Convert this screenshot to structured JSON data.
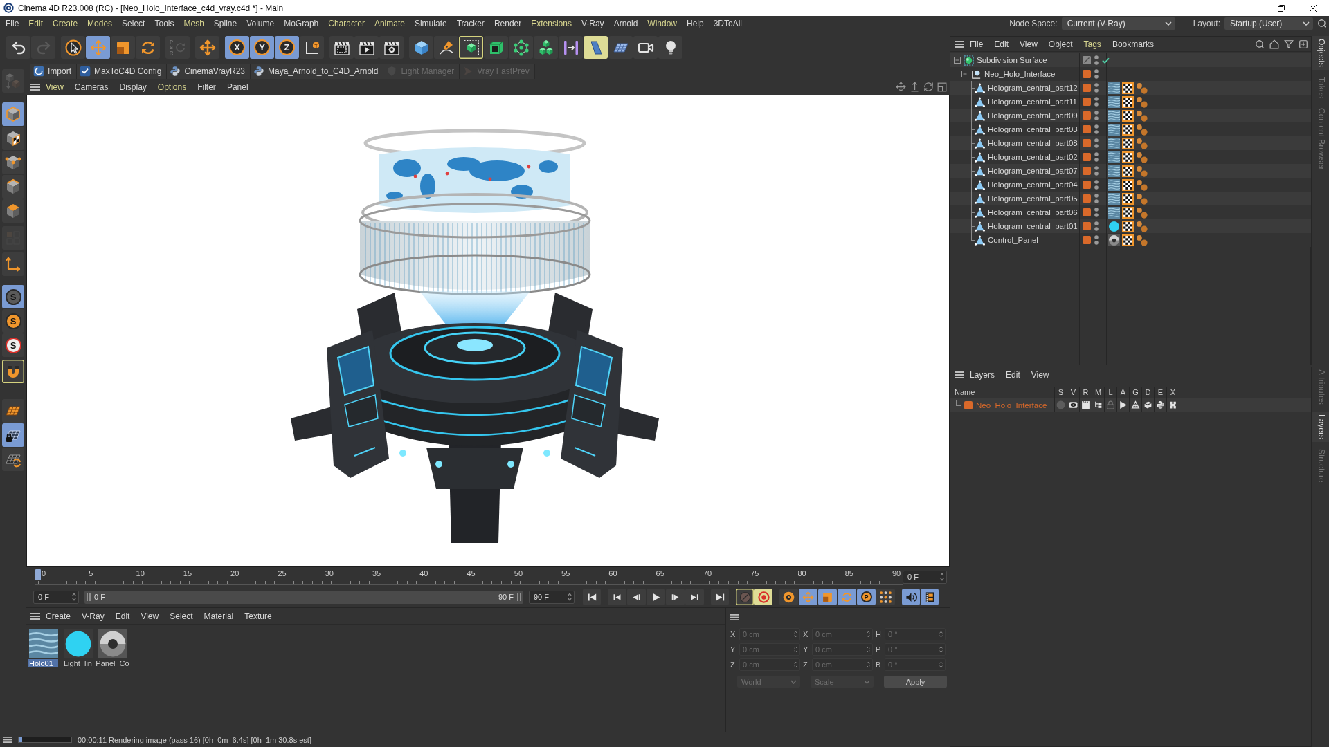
{
  "window": {
    "title": "Cinema 4D R23.008 (RC) - [Neo_Holo_Interface_c4d_vray.c4d *] - Main"
  },
  "menu_bar": [
    {
      "label": "File",
      "highlighted": false
    },
    {
      "label": "Edit",
      "highlighted": true
    },
    {
      "label": "Create",
      "highlighted": true
    },
    {
      "label": "Modes",
      "highlighted": true
    },
    {
      "label": "Select",
      "highlighted": false
    },
    {
      "label": "Tools",
      "highlighted": false
    },
    {
      "label": "Mesh",
      "highlighted": true
    },
    {
      "label": "Spline",
      "highlighted": false
    },
    {
      "label": "Volume",
      "highlighted": false
    },
    {
      "label": "MoGraph",
      "highlighted": false
    },
    {
      "label": "Character",
      "highlighted": true
    },
    {
      "label": "Animate",
      "highlighted": true
    },
    {
      "label": "Simulate",
      "highlighted": false
    },
    {
      "label": "Tracker",
      "highlighted": false
    },
    {
      "label": "Render",
      "highlighted": false
    },
    {
      "label": "Extensions",
      "highlighted": true
    },
    {
      "label": "V-Ray",
      "highlighted": false
    },
    {
      "label": "Arnold",
      "highlighted": false
    },
    {
      "label": "Window",
      "highlighted": true
    },
    {
      "label": "Help",
      "highlighted": false
    },
    {
      "label": "3DToAll",
      "highlighted": false
    }
  ],
  "node_space": {
    "label": "Node Space:",
    "value": "Current (V-Ray)"
  },
  "layout": {
    "label": "Layout:",
    "value": "Startup (User)"
  },
  "toolbar": [
    {
      "buttons": [
        {
          "kind": "undo",
          "selected": false,
          "highlighted": false,
          "outlined": false,
          "disabled": false
        },
        {
          "kind": "redo",
          "selected": false,
          "highlighted": false,
          "outlined": false,
          "disabled": true
        }
      ]
    },
    {
      "buttons": [
        {
          "kind": "select",
          "selected": false,
          "highlighted": false,
          "outlined": false,
          "disabled": false
        },
        {
          "kind": "move",
          "selected": true,
          "highlighted": false,
          "outlined": false,
          "disabled": false
        },
        {
          "kind": "scale",
          "selected": false,
          "highlighted": false,
          "outlined": false,
          "disabled": false
        },
        {
          "kind": "rotate",
          "selected": false,
          "highlighted": false,
          "outlined": false,
          "disabled": false
        }
      ]
    },
    {
      "buttons": [
        {
          "kind": "psr",
          "label": "PSR",
          "selected": false,
          "highlighted": false,
          "outlined": false,
          "disabled": true
        }
      ]
    },
    {
      "buttons": [
        {
          "kind": "axis-move",
          "selected": false,
          "highlighted": false,
          "outlined": false,
          "disabled": false
        }
      ]
    },
    {
      "buttons": [
        {
          "kind": "axis",
          "label": "X",
          "selected": true,
          "highlighted": false,
          "outlined": false,
          "disabled": false
        },
        {
          "kind": "axis",
          "label": "Y",
          "selected": true,
          "highlighted": false,
          "outlined": false,
          "disabled": false
        },
        {
          "kind": "axis",
          "label": "Z",
          "selected": true,
          "highlighted": false,
          "outlined": false,
          "disabled": false
        },
        {
          "kind": "coordinates",
          "selected": false,
          "highlighted": false,
          "outlined": false,
          "disabled": false
        }
      ]
    },
    {
      "buttons": [
        {
          "kind": "render-region",
          "selected": false,
          "highlighted": false,
          "outlined": false,
          "disabled": false
        },
        {
          "kind": "render-view",
          "selected": false,
          "highlighted": false,
          "outlined": false,
          "disabled": false
        },
        {
          "kind": "render-settings",
          "selected": false,
          "highlighted": false,
          "outlined": false,
          "disabled": false
        }
      ]
    },
    {
      "buttons": [
        {
          "kind": "cube",
          "selected": false,
          "highlighted": false,
          "outlined": false,
          "disabled": false
        },
        {
          "kind": "pen",
          "selected": false,
          "highlighted": false,
          "outlined": false,
          "disabled": false
        },
        {
          "kind": "subdivision",
          "selected": false,
          "highlighted": false,
          "outlined": true,
          "disabled": false
        },
        {
          "kind": "extrude",
          "selected": false,
          "highlighted": false,
          "outlined": false,
          "disabled": false
        },
        {
          "kind": "cloner",
          "selected": false,
          "highlighted": false,
          "outlined": false,
          "disabled": false
        },
        {
          "kind": "array",
          "selected": false,
          "highlighted": false,
          "outlined": false,
          "disabled": false
        },
        {
          "kind": "deformer",
          "selected": false,
          "highlighted": false,
          "outlined": false,
          "disabled": false
        },
        {
          "kind": "field",
          "selected": false,
          "highlighted": true,
          "outlined": false,
          "disabled": false
        },
        {
          "kind": "floor",
          "selected": false,
          "highlighted": false,
          "outlined": false,
          "disabled": false
        },
        {
          "kind": "camera",
          "selected": false,
          "highlighted": false,
          "outlined": false,
          "disabled": false
        },
        {
          "kind": "light",
          "selected": false,
          "highlighted": false,
          "outlined": false,
          "disabled": false
        }
      ]
    }
  ],
  "plugin_bar": [
    {
      "kind": "import",
      "label": "Import",
      "disabled": false
    },
    {
      "kind": "config",
      "label": "MaxToC4D Config",
      "disabled": false
    },
    {
      "kind": "script",
      "label": "CinemaVrayR23",
      "disabled": false
    },
    {
      "kind": "script",
      "label": "Maya_Arnold_to_C4D_Arnold",
      "disabled": false
    },
    {
      "kind": "light-manager",
      "label": "Light Manager",
      "disabled": true
    },
    {
      "kind": "fast-preview",
      "label": "Vray FastPrev",
      "disabled": true
    }
  ],
  "left_toolbar": [
    {
      "buttons": [
        {
          "kind": "make-editable",
          "selected": false,
          "highlighted": false,
          "outlined": false,
          "disabled": true
        }
      ]
    },
    {
      "buttons": [
        {
          "kind": "model",
          "selected": true,
          "highlighted": false,
          "outlined": false,
          "disabled": false
        },
        {
          "kind": "texture",
          "selected": false,
          "highlighted": false,
          "outlined": false,
          "disabled": false
        },
        {
          "kind": "points",
          "selected": false,
          "highlighted": false,
          "outlined": false,
          "disabled": false
        },
        {
          "kind": "edges",
          "selected": false,
          "highlighted": false,
          "outlined": false,
          "disabled": false
        },
        {
          "kind": "polygons",
          "selected": false,
          "highlighted": false,
          "outlined": false,
          "disabled": false
        }
      ]
    },
    {
      "buttons": [
        {
          "kind": "uv",
          "selected": false,
          "highlighted": false,
          "outlined": false,
          "disabled": true
        }
      ]
    },
    {
      "buttons": [
        {
          "kind": "axis-mode",
          "selected": false,
          "highlighted": false,
          "outlined": false,
          "disabled": false
        }
      ]
    },
    {
      "buttons": [
        {
          "kind": "snap",
          "label": "S",
          "selected": true,
          "highlighted": false,
          "outlined": false,
          "disabled": false
        },
        {
          "kind": "snap-quantize",
          "label": "S",
          "selected": false,
          "highlighted": false,
          "outlined": false,
          "disabled": false
        },
        {
          "kind": "snap-workplane",
          "label": "S",
          "selected": false,
          "highlighted": false,
          "outlined": false,
          "disabled": false
        }
      ]
    },
    {
      "buttons": [
        {
          "kind": "magnet",
          "selected": false,
          "highlighted": false,
          "outlined": true,
          "disabled": false
        }
      ]
    },
    {
      "buttons": [
        {
          "kind": "grid",
          "selected": false,
          "highlighted": false,
          "outlined": false,
          "disabled": false
        },
        {
          "kind": "grid-lock",
          "selected": true,
          "highlighted": false,
          "outlined": false,
          "disabled": false
        },
        {
          "kind": "grid-refresh",
          "selected": false,
          "highlighted": false,
          "outlined": false,
          "disabled": false
        }
      ]
    }
  ],
  "viewport": {
    "menu": [
      {
        "label": "View",
        "highlighted": true
      },
      {
        "label": "Cameras",
        "highlighted": false
      },
      {
        "label": "Display",
        "highlighted": false
      },
      {
        "label": "Options",
        "highlighted": true
      },
      {
        "label": "Filter",
        "highlighted": false
      },
      {
        "label": "Panel",
        "highlighted": false
      }
    ]
  },
  "timeline": {
    "ticks": [
      "0",
      "5",
      "10",
      "15",
      "20",
      "25",
      "30",
      "35",
      "40",
      "45",
      "50",
      "55",
      "60",
      "65",
      "70",
      "75",
      "80",
      "85",
      "90"
    ],
    "playhead": {
      "level": 0
    },
    "frame": "0 F"
  },
  "time_controls": {
    "start": "0 F",
    "range": {
      "start": "0 F",
      "end": "90 F",
      "handles": [
        {
          "level": 0
        },
        {
          "level": 1
        }
      ]
    },
    "end": "90 F",
    "groups": [
      {
        "buttons": [
          {
            "kind": "go-start",
            "selected": false,
            "highlighted": false,
            "outlined": false
          }
        ]
      },
      {
        "buttons": [
          {
            "kind": "prev-key",
            "selected": false,
            "highlighted": false,
            "outlined": false
          },
          {
            "kind": "prev-frame",
            "selected": false,
            "highlighted": false,
            "outlined": false
          },
          {
            "kind": "play",
            "selected": false,
            "highlighted": false,
            "outlined": false
          },
          {
            "kind": "next-frame",
            "selected": false,
            "highlighted": false,
            "outlined": false
          },
          {
            "kind": "next-key",
            "selected": false,
            "highlighted": false,
            "outlined": false
          }
        ]
      },
      {
        "buttons": [
          {
            "kind": "go-end",
            "selected": false,
            "highlighted": false,
            "outlined": false
          }
        ]
      },
      {
        "buttons": [
          {
            "kind": "auto-key",
            "selected": false,
            "highlighted": false,
            "outlined": true
          },
          {
            "kind": "record",
            "selected": false,
            "highlighted": true,
            "outlined": false
          }
        ]
      },
      {
        "buttons": [
          {
            "kind": "key-selection",
            "selected": false,
            "highlighted": false,
            "outlined": false
          },
          {
            "kind": "key-position",
            "selected": true,
            "highlighted": false,
            "outlined": false
          },
          {
            "kind": "key-scale",
            "selected": true,
            "highlighted": false,
            "outlined": false
          },
          {
            "kind": "key-rotation",
            "selected": true,
            "highlighted": false,
            "outlined": false
          },
          {
            "kind": "key-parameter",
            "label": "P",
            "selected": true,
            "highlighted": false,
            "outlined": false
          },
          {
            "kind": "key-pla",
            "selected": false,
            "highlighted": false,
            "outlined": false
          }
        ]
      },
      {
        "buttons": [
          {
            "kind": "sound",
            "selected": true,
            "highlighted": false,
            "outlined": false
          },
          {
            "kind": "film",
            "selected": true,
            "highlighted": false,
            "outlined": false
          }
        ]
      }
    ]
  },
  "material_manager": {
    "menu": [
      "Create",
      "V-Ray",
      "Edit",
      "View",
      "Select",
      "Material",
      "Texture"
    ],
    "materials": [
      {
        "name": "Holo01_",
        "kind": "holo-material",
        "selected": true
      },
      {
        "name": "Light_lin",
        "kind": "light-material",
        "selected": false
      },
      {
        "name": "Panel_Co",
        "kind": "panel-material",
        "selected": false
      }
    ]
  },
  "coordinates": {
    "disabled": true,
    "columns": [
      {
        "header": "--",
        "fields": [
          {
            "axis": "X",
            "value": "0 cm"
          },
          {
            "axis": "Y",
            "value": "0 cm"
          },
          {
            "axis": "Z",
            "value": "0 cm"
          }
        ]
      },
      {
        "header": "--",
        "fields": [
          {
            "axis": "X",
            "value": "0 cm"
          },
          {
            "axis": "Y",
            "value": "0 cm"
          },
          {
            "axis": "Z",
            "value": "0 cm"
          }
        ]
      },
      {
        "header": "--",
        "fields": [
          {
            "axis": "H",
            "value": "0 °"
          },
          {
            "axis": "P",
            "value": "0 °"
          },
          {
            "axis": "B",
            "value": "0 °"
          }
        ]
      }
    ],
    "dropdowns": [
      "World",
      "Scale"
    ],
    "apply": "Apply"
  },
  "status_bar": {
    "progress": {
      "level": 0.06
    },
    "message": "00:00:11 Rendering image (pass 16) [0h  0m  6.4s] [0h  1m 30.8s est]"
  },
  "object_manager": {
    "menu": [
      {
        "label": "File",
        "highlighted": false
      },
      {
        "label": "Edit",
        "highlighted": false
      },
      {
        "label": "View",
        "highlighted": false
      },
      {
        "label": "Object",
        "highlighted": false
      },
      {
        "label": "Tags",
        "highlighted": true
      },
      {
        "label": "Bookmarks",
        "highlighted": false
      }
    ],
    "tree": [
      {
        "name": "Subdivision Surface",
        "kind": "generator",
        "expanded": true,
        "in_layer": false,
        "enabled": true,
        "children": [
          {
            "name": "Neo_Holo_Interface",
            "kind": "null",
            "expanded": true,
            "in_layer": true,
            "children": [
              {
                "name": "Hologram_central_part12",
                "kind": "polygon",
                "in_layer": true,
                "tags": [
                  {
                    "kind": "holo-material"
                  },
                  {
                    "kind": "uvw"
                  },
                  {
                    "kind": "phong"
                  }
                ]
              },
              {
                "name": "Hologram_central_part11",
                "kind": "polygon",
                "in_layer": true,
                "tags": [
                  {
                    "kind": "holo-material"
                  },
                  {
                    "kind": "uvw"
                  },
                  {
                    "kind": "phong"
                  }
                ]
              },
              {
                "name": "Hologram_central_part09",
                "kind": "polygon",
                "in_layer": true,
                "tags": [
                  {
                    "kind": "holo-material"
                  },
                  {
                    "kind": "uvw"
                  },
                  {
                    "kind": "phong"
                  }
                ]
              },
              {
                "name": "Hologram_central_part03",
                "kind": "polygon",
                "in_layer": true,
                "tags": [
                  {
                    "kind": "holo-material"
                  },
                  {
                    "kind": "uvw"
                  },
                  {
                    "kind": "phong"
                  }
                ]
              },
              {
                "name": "Hologram_central_part08",
                "kind": "polygon",
                "in_layer": true,
                "tags": [
                  {
                    "kind": "holo-material"
                  },
                  {
                    "kind": "uvw"
                  },
                  {
                    "kind": "phong"
                  }
                ]
              },
              {
                "name": "Hologram_central_part02",
                "kind": "polygon",
                "in_layer": true,
                "tags": [
                  {
                    "kind": "holo-material"
                  },
                  {
                    "kind": "uvw"
                  },
                  {
                    "kind": "phong"
                  }
                ]
              },
              {
                "name": "Hologram_central_part07",
                "kind": "polygon",
                "in_layer": true,
                "tags": [
                  {
                    "kind": "holo-material"
                  },
                  {
                    "kind": "uvw"
                  },
                  {
                    "kind": "phong"
                  }
                ]
              },
              {
                "name": "Hologram_central_part04",
                "kind": "polygon",
                "in_layer": true,
                "tags": [
                  {
                    "kind": "holo-material"
                  },
                  {
                    "kind": "uvw"
                  },
                  {
                    "kind": "phong"
                  }
                ]
              },
              {
                "name": "Hologram_central_part05",
                "kind": "polygon",
                "in_layer": true,
                "tags": [
                  {
                    "kind": "holo-material"
                  },
                  {
                    "kind": "uvw"
                  },
                  {
                    "kind": "phong"
                  }
                ]
              },
              {
                "name": "Hologram_central_part06",
                "kind": "polygon",
                "in_layer": true,
                "tags": [
                  {
                    "kind": "holo-material"
                  },
                  {
                    "kind": "uvw"
                  },
                  {
                    "kind": "phong"
                  }
                ]
              },
              {
                "name": "Hologram_central_part01",
                "kind": "polygon",
                "in_layer": true,
                "tags": [
                  {
                    "kind": "light-material"
                  },
                  {
                    "kind": "uvw"
                  },
                  {
                    "kind": "phong"
                  }
                ]
              },
              {
                "name": "Control_Panel",
                "kind": "polygon",
                "in_layer": true,
                "tags": [
                  {
                    "kind": "panel-material"
                  },
                  {
                    "kind": "uvw"
                  },
                  {
                    "kind": "phong"
                  }
                ]
              }
            ]
          }
        ]
      }
    ]
  },
  "side_tabs_upper": [
    {
      "label": "Objects",
      "selected": true
    },
    {
      "label": "Takes",
      "selected": false
    },
    {
      "label": "Content Browser",
      "selected": false
    }
  ],
  "layer_manager": {
    "menu": [
      "Layers",
      "Edit",
      "View"
    ],
    "columns": [
      "Name",
      "S",
      "V",
      "R",
      "M",
      "L",
      "A",
      "G",
      "D",
      "E",
      "X"
    ],
    "rows": [
      {
        "name": "Neo_Holo_Interface",
        "color": "#d9692a",
        "flags": [
          {
            "on": false
          },
          {
            "on": true
          },
          {
            "on": true
          },
          {
            "on": true
          },
          {
            "on": false
          },
          {
            "on": true
          },
          {
            "on": true
          },
          {
            "on": true
          },
          {
            "on": true
          },
          {
            "on": true
          }
        ]
      }
    ]
  },
  "side_tabs_lower": [
    {
      "label": "Attributes",
      "selected": false
    },
    {
      "label": "Layers",
      "selected": true
    },
    {
      "label": "Structure",
      "selected": false
    }
  ]
}
